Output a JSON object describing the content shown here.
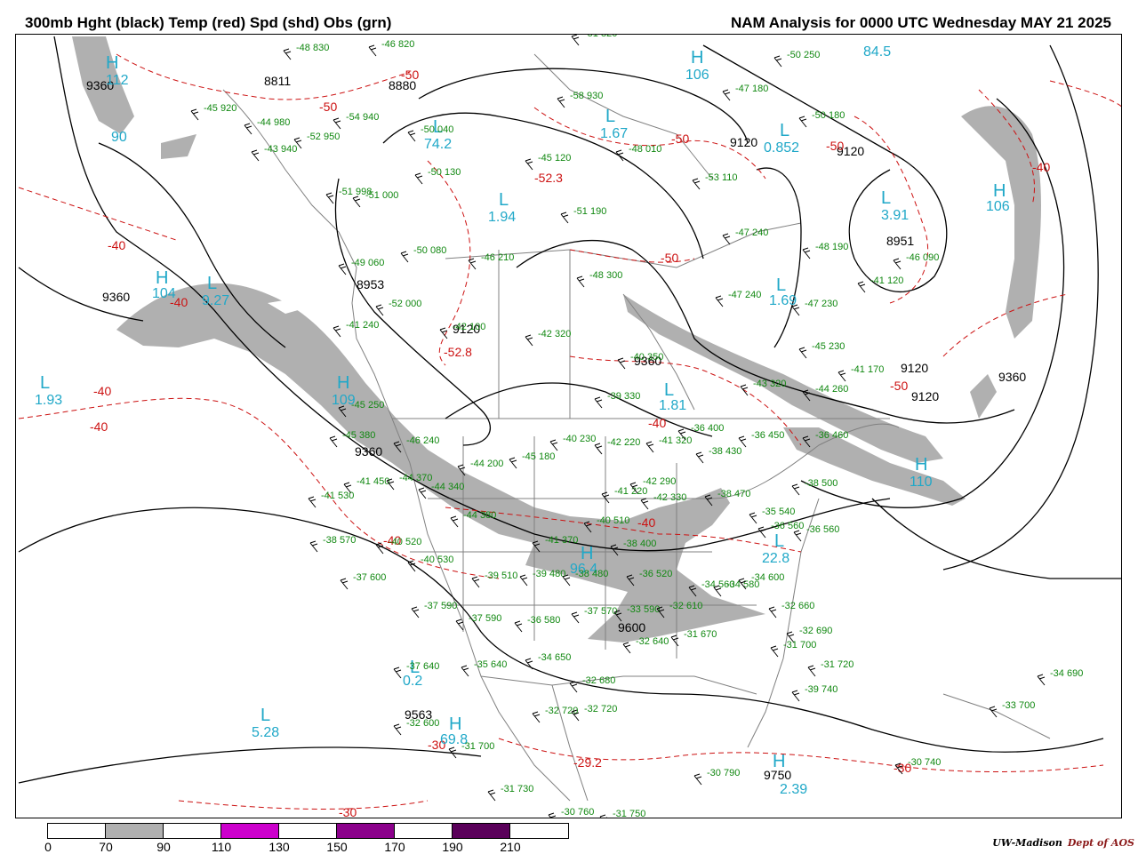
{
  "header": {
    "left_title": "300mb Hght (black) Temp (red) Spd (shd) Obs (grn)",
    "right_title": "NAM Analysis for 0000 UTC Wednesday  MAY 21 2025"
  },
  "legend": {
    "colorbar_labels": [
      "0",
      "70",
      "90",
      "110",
      "130",
      "150",
      "170",
      "190",
      "210"
    ],
    "colorbar_colors": [
      "#ffffff",
      "#b0b0b0",
      "#ffffff",
      "#cc00cc",
      "#ffffff",
      "#8b008b",
      "#ffffff",
      "#5a005a",
      "#ffffff"
    ]
  },
  "credit": {
    "org": "UW-Madison",
    "dept": "Dept of AOS"
  },
  "colors": {
    "height": "#000000",
    "temp": "#cc1111",
    "speed_shade": "#b0b0b0",
    "obs": "#118811",
    "centers": "#20a8c8",
    "borders": "#808080"
  },
  "map": {
    "height_labels": [
      "9360",
      "8811",
      "8880",
      "9120",
      "9120",
      "8951",
      "9360",
      "8953",
      "9120",
      "9360",
      "9120",
      "9120",
      "9360",
      "9360",
      "9563",
      "9600",
      "9750"
    ],
    "temp_labels": [
      "-50",
      "-50",
      "-50",
      "-50",
      "-40",
      "-40",
      "-40",
      "-40",
      "-52.8",
      "-40",
      "-50",
      "-52.3",
      "-40",
      "-40",
      "-40",
      "-30",
      "-30",
      "-29.2",
      "-30",
      "-50"
    ],
    "centers": [
      {
        "type": "H",
        "value": "112"
      },
      {
        "type": "H",
        "value": "106"
      },
      {
        "type": "L",
        "value": "0.852"
      },
      {
        "type": "L",
        "value": "3.91"
      },
      {
        "type": "H",
        "value": "106"
      },
      {
        "type": "L",
        "value": "1.94"
      },
      {
        "type": "L",
        "value": "1.67"
      },
      {
        "type": "L",
        "value": "74.2"
      },
      {
        "type": "L",
        "value": "9.27"
      },
      {
        "type": "H",
        "value": "104"
      },
      {
        "type": "L",
        "value": "1.93"
      },
      {
        "type": "H",
        "value": "109"
      },
      {
        "type": "L",
        "value": "1.69"
      },
      {
        "type": "L",
        "value": "1.81"
      },
      {
        "type": "H",
        "value": "110"
      },
      {
        "type": "H",
        "value": "96.4"
      },
      {
        "type": "L",
        "value": "22.8"
      },
      {
        "type": "L",
        "value": "5.28"
      },
      {
        "type": "H",
        "value": "69.8"
      },
      {
        "type": "H",
        "value": "2.39"
      },
      {
        "type": "L",
        "value": "0.2"
      },
      {
        "type": "",
        "value": "84.5"
      },
      {
        "type": "",
        "value": "90"
      }
    ],
    "observations": [
      "-48 830",
      "-46 820",
      "-45 920",
      "-44 980",
      "-52 950",
      "-43 940",
      "-54 940",
      "-50 040",
      "-51 998",
      "-51 000",
      "-50 130",
      "-50 080",
      "-46 210",
      "-49 060",
      "-52 000",
      "-42 100",
      "-41 240",
      "-42 320",
      "-48 300",
      "-51 190",
      "-58 930",
      "-45 120",
      "-48 010",
      "-53 110",
      "-47 240",
      "-48 190",
      "-47 240",
      "-47 230",
      "-46 090",
      "-41 120",
      "-45 230",
      "-41 170",
      "-44 260",
      "-43 320",
      "-39 330",
      "-40 350",
      "-45 250",
      "-45 380",
      "-46 240",
      "-44 200",
      "-45 180",
      "-40 230",
      "-42 220",
      "-41 320",
      "-36 400",
      "-38 430",
      "-36 450",
      "-36 460",
      "-38 500",
      "-41 450",
      "-41 530",
      "-44 370",
      "-44 340",
      "-41 220",
      "-42 290",
      "-42 330",
      "-38 470",
      "-35 540",
      "-36 560",
      "-36 560",
      "-38 570",
      "-40 520",
      "-40 530",
      "-37 600",
      "-44 380",
      "-40 510",
      "-41 370",
      "-38 400",
      "-39 510",
      "-39 480",
      "-38 480",
      "-36 520",
      "-34 560",
      "-34 580",
      "-34 600",
      "-32 660",
      "-32 690",
      "-37 590",
      "-37 590",
      "-36 580",
      "-37 570",
      "-33 590",
      "-32 610",
      "-32 640",
      "-31 670",
      "-31 700",
      "-31 720",
      "-39 740",
      "-37 640",
      "-35 640",
      "-34 650",
      "-32 680",
      "-32 720",
      "-32 720",
      "-32 600",
      "-31 700",
      "-31 730",
      "-30 760",
      "-31 750",
      "-30 790",
      "-30 740",
      "-34 690",
      "-33 700",
      "-50 250",
      "-50 180",
      "-47 180",
      "-51 820"
    ]
  }
}
